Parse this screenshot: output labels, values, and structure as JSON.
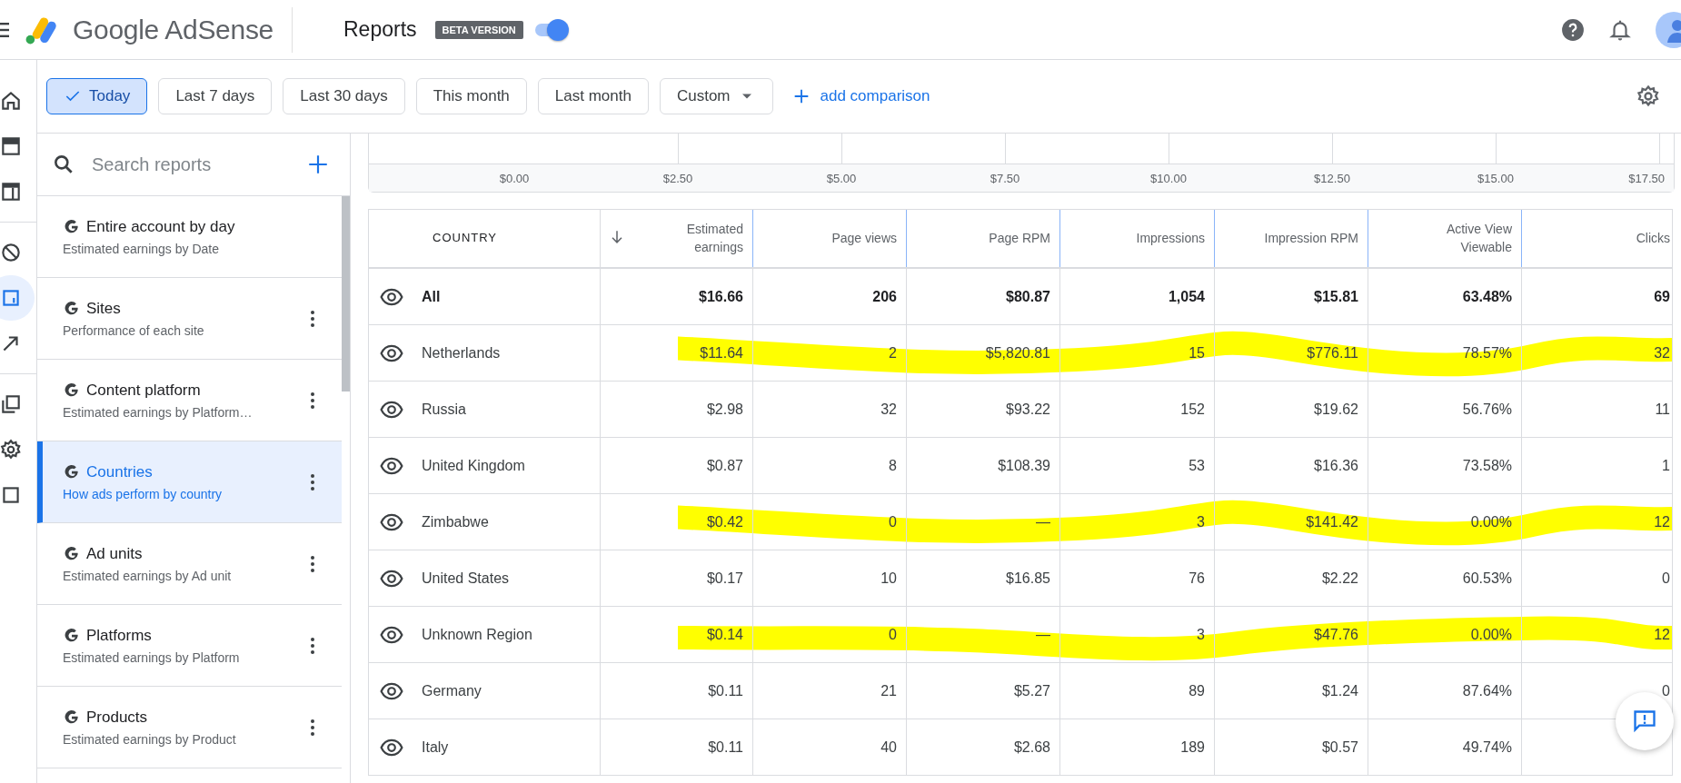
{
  "header": {
    "product": "Google AdSense",
    "page_title": "Reports",
    "badge": "BETA VERSION",
    "beta_toggle": {
      "on": true
    }
  },
  "nav_rail": {
    "items": [
      {
        "kind": "home",
        "selected": false
      },
      {
        "kind": "adbox",
        "selected": false
      },
      {
        "kind": "layout",
        "selected": false
      },
      {
        "kind": "block",
        "selected": false
      },
      {
        "kind": "reports",
        "selected": true
      },
      {
        "kind": "trend",
        "selected": false
      },
      {
        "kind": "copies",
        "selected": false
      },
      {
        "kind": "gear",
        "selected": false
      },
      {
        "kind": "square",
        "selected": false
      }
    ]
  },
  "date_filters": [
    {
      "label": "Today",
      "selected": true
    },
    {
      "label": "Last 7 days",
      "selected": false
    },
    {
      "label": "Last 30 days",
      "selected": false
    },
    {
      "label": "This month",
      "selected": false
    },
    {
      "label": "Last month",
      "selected": false
    },
    {
      "label": "Custom",
      "selected": false,
      "dropdown": true
    }
  ],
  "add_comparison": "add comparison",
  "sidebar": {
    "search": {
      "placeholder": "Search reports"
    },
    "items": [
      {
        "title": "Entire account by day",
        "subtitle": "Estimated earnings by Date",
        "selected": false,
        "menu": false
      },
      {
        "title": "Sites",
        "subtitle": "Performance of each site",
        "selected": false,
        "menu": true
      },
      {
        "title": "Content platform",
        "subtitle": "Estimated earnings by Platform…",
        "selected": false,
        "menu": true
      },
      {
        "title": "Countries",
        "subtitle": "How ads perform by country",
        "selected": true,
        "menu": true
      },
      {
        "title": "Ad units",
        "subtitle": "Estimated earnings by Ad unit",
        "selected": false,
        "menu": true
      },
      {
        "title": "Platforms",
        "subtitle": "Estimated earnings by Platform",
        "selected": false,
        "menu": true
      },
      {
        "title": "Products",
        "subtitle": "Estimated earnings by Product",
        "selected": false,
        "menu": true
      }
    ]
  },
  "chart_axis": {
    "ticks": [
      "$0.00",
      "$2.50",
      "$5.00",
      "$7.50",
      "$10.00",
      "$12.50",
      "$15.00",
      "$17.50"
    ]
  },
  "table": {
    "columns": [
      {
        "label": "COUNTRY",
        "sorted": false
      },
      {
        "label": "Estimated earnings",
        "sorted": true
      },
      {
        "label": "Page views",
        "sorted": false
      },
      {
        "label": "Page RPM",
        "sorted": false
      },
      {
        "label": "Impressions",
        "sorted": false
      },
      {
        "label": "Impression RPM",
        "sorted": false
      },
      {
        "label": "Active View Viewable",
        "sorted": false
      },
      {
        "label": "Clicks",
        "sorted": false
      }
    ],
    "rows": [
      {
        "kind": "total",
        "cells": [
          "All",
          "$16.66",
          "206",
          "$80.87",
          "1,054",
          "$15.81",
          "63.48%",
          "69"
        ],
        "highlighted": false
      },
      {
        "kind": "country",
        "cells": [
          "Netherlands",
          "$11.64",
          "2",
          "$5,820.81",
          "15",
          "$776.11",
          "78.57%",
          "32"
        ],
        "highlighted": true
      },
      {
        "kind": "country",
        "cells": [
          "Russia",
          "$2.98",
          "32",
          "$93.22",
          "152",
          "$19.62",
          "56.76%",
          "11"
        ],
        "highlighted": false
      },
      {
        "kind": "country",
        "cells": [
          "United Kingdom",
          "$0.87",
          "8",
          "$108.39",
          "53",
          "$16.36",
          "73.58%",
          "1"
        ],
        "highlighted": false
      },
      {
        "kind": "country",
        "cells": [
          "Zimbabwe",
          "$0.42",
          "0",
          "—",
          "3",
          "$141.42",
          "0.00%",
          "12"
        ],
        "highlighted": true
      },
      {
        "kind": "country",
        "cells": [
          "United States",
          "$0.17",
          "10",
          "$16.85",
          "76",
          "$2.22",
          "60.53%",
          "0"
        ],
        "highlighted": false
      },
      {
        "kind": "country",
        "cells": [
          "Unknown Region",
          "$0.14",
          "0",
          "—",
          "3",
          "$47.76",
          "0.00%",
          "12"
        ],
        "highlighted": true
      },
      {
        "kind": "country",
        "cells": [
          "Germany",
          "$0.11",
          "21",
          "$5.27",
          "89",
          "$1.24",
          "87.64%",
          "0"
        ],
        "highlighted": false
      },
      {
        "kind": "country",
        "cells": [
          "Italy",
          "$0.11",
          "40",
          "$2.68",
          "189",
          "$0.57",
          "49.74%",
          ""
        ],
        "highlighted": false
      }
    ]
  }
}
